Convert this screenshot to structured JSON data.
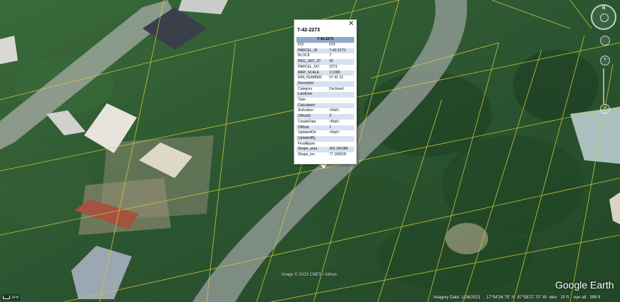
{
  "popup": {
    "title": "7-42-2273",
    "table_header": "7-42-2273",
    "close_glyph": "✕",
    "rows": [
      {
        "key": "FID",
        "value": "679"
      },
      {
        "key": "PARCEL_ID",
        "value": "7-42-2273"
      },
      {
        "key": "BLOCK",
        "value": "7"
      },
      {
        "key": "REG_SEC_ID",
        "value": "42"
      },
      {
        "key": "PARCEL_NO",
        "value": "2273"
      },
      {
        "key": "MAP_SCALE",
        "value": "1:1000"
      },
      {
        "key": "RIM_NUMBER",
        "value": "07 42 13"
      },
      {
        "key": "Descriptio",
        "value": ""
      },
      {
        "key": "Category",
        "value": "Declared"
      },
      {
        "key": "LandUse",
        "value": ""
      },
      {
        "key": "Type",
        "value": ""
      },
      {
        "key": "Calculated",
        "value": ""
      },
      {
        "key": "Activation",
        "value": "<Null>"
      },
      {
        "key": "OfficeID",
        "value": "3"
      },
      {
        "key": "CreateDate",
        "value": "<Null>"
      },
      {
        "key": "Official",
        "value": "1"
      },
      {
        "key": "UpdatedOn",
        "value": "<Null>"
      },
      {
        "key": "UpdatedBy",
        "value": ""
      },
      {
        "key": "FinalAppro",
        "value": ""
      },
      {
        "key": "Shape_area",
        "value": "362.341086"
      },
      {
        "key": "Shape_len",
        "value": "77.165528"
      }
    ]
  },
  "map": {
    "copyright": "Image © 2023 CNES / Airbus",
    "logo": "Google Earth",
    "scale_label": "10 ft",
    "status": {
      "imagery_date": "Imagery Date: 1/26/2021",
      "lat": "17°54'36.75\" N",
      "lon": "87°58'27.70\" W",
      "elev_label": "elev",
      "elev": "20 ft",
      "eye_label": "eye alt",
      "eye": "399 ft"
    },
    "compass_n": "N",
    "colors": {
      "vegetation": "#2f5a30",
      "road": "#8d9890",
      "parcel_line": "#d8cf3a",
      "popup_header": "#8fa8c8",
      "popup_alt_row": "#d7e2f1"
    }
  },
  "nav": {
    "look_icon": "look-joystick-icon",
    "move_icon": "move-joystick-icon",
    "zoom_in": "+",
    "zoom_out": "−"
  }
}
